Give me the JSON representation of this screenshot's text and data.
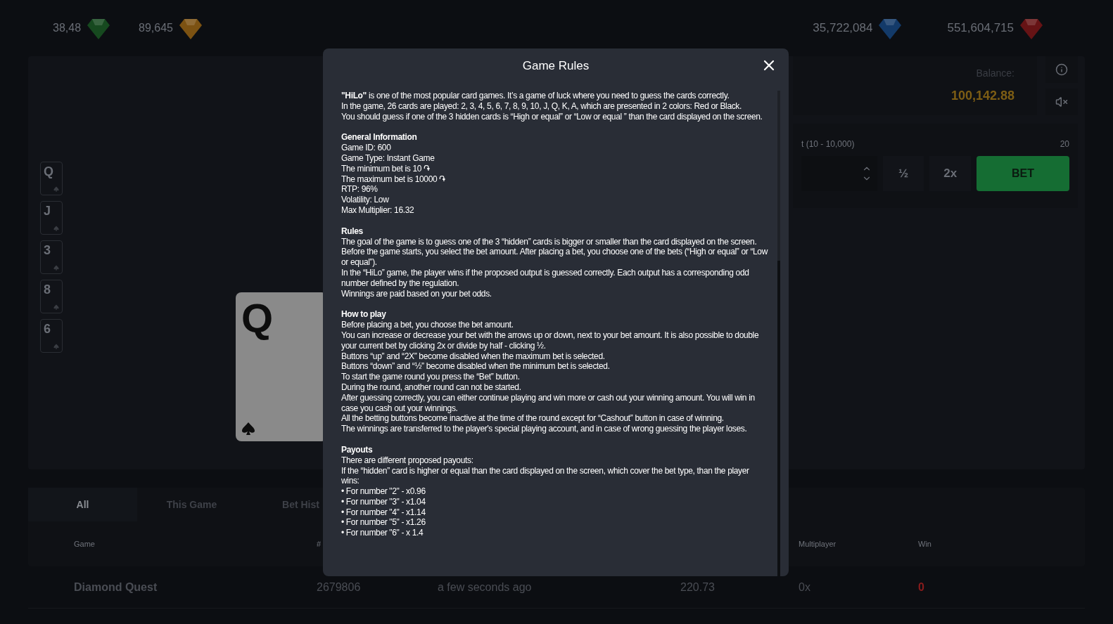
{
  "jackpots": [
    {
      "value": "38,48"
    },
    {
      "value": "89,645"
    },
    {
      "value": "35,722,084"
    },
    {
      "value": "551,604,715"
    }
  ],
  "card_history": [
    {
      "rank": "Q"
    },
    {
      "rank": "J"
    },
    {
      "rank": "3"
    },
    {
      "rank": "8"
    },
    {
      "rank": "6"
    }
  ],
  "current_card": {
    "rank": "Q"
  },
  "balance": {
    "label": "Balance:",
    "value": "100,142.88"
  },
  "bet": {
    "range_label": "t (10 - 10,000)",
    "value": "20",
    "half_button": "½",
    "double_button": "2x",
    "bet_button": "BET"
  },
  "history_tabs": [
    {
      "label": "All",
      "selected": true
    },
    {
      "label": "This Game",
      "selected": false
    },
    {
      "label": "Bet Hist",
      "selected": false
    }
  ],
  "history_table": {
    "columns": [
      "Game",
      "#",
      "Multiplayer",
      "Win"
    ],
    "rows": [
      {
        "game": "Diamond Quest",
        "id": "2679806",
        "time": "a few seconds ago",
        "amount": "220.73",
        "multiplier": "0x",
        "win": "0"
      }
    ]
  },
  "modal": {
    "title": "Game Rules",
    "intro": [
      "**\"HiLo\"** is one of the most popular card games. It’s a game of luck where you need to guess the cards correctly.",
      "In the game, 26 cards are played: 2, 3, 4, 5, 6, 7, 8, 9, 10, J, Q, K, A, which are presented in 2 colors: Red or Black.",
      "You should guess if one of the 3 hidden cards is “High or equal” or “Low or equal ” than the card displayed on the screen."
    ],
    "sections": [
      {
        "heading": "General Information",
        "lines": [
          "Game ID: 600",
          "Game Type: Instant Game",
          "The minimum bet is 10 ֏",
          "The maximum bet is 10000 ֏",
          "RTP: 96%",
          "Volatility: Low",
          "Max Multiplier: 16.32"
        ]
      },
      {
        "heading": "Rules",
        "lines": [
          "The goal of the game is to guess one of the 3 “hidden” cards is bigger or smaller than the card displayed on the screen.",
          "Before the game starts, you select the bet amount. After placing a bet, you choose one of the bets (“High or equal” or “Low or equal”).",
          "In the “HiLo” game, the player wins if the proposed output is guessed correctly. Each output has a corresponding odd number defined by the regulation.",
          "Winnings are paid based on your bet odds."
        ]
      },
      {
        "heading": "How to play",
        "lines": [
          "Before placing a bet, you choose the bet amount.",
          "You can increase or decrease your bet with the arrows up or down, next to your bet amount. It is also possible to double your current bet by clicking 2x or divide by half - clicking ½.",
          "Buttons “up” and “2X” become disabled when the maximum bet is selected.",
          "Buttons “down” and “½” become disabled when the minimum bet is selected.",
          "To start the game round you press the “Bet” button.",
          "During the round, another round can not be started.",
          "After guessing correctly, you can either continue playing and win more or cash out your winning amount. You will win in case you cash out your winnings.",
          "All the betting buttons become inactive at the time of the round except for “Cashout” button in case of winning.",
          "The winnings are transferred to the player's special playing account, and in case of wrong guessing the player loses."
        ]
      },
      {
        "heading": "Payouts",
        "lines": [
          "There are different proposed payouts:",
          "If the “hidden” card is higher or equal than the card displayed on the screen, which cover the bet type, than the player wins:",
          "• For number \"2\" - x0.96",
          "• For number \"3\" - x1.04",
          "• For number \"4\" - x1.14",
          "• For number \"5\" - x1.26",
          "• For number \"6\" - x 1.4"
        ]
      }
    ]
  }
}
